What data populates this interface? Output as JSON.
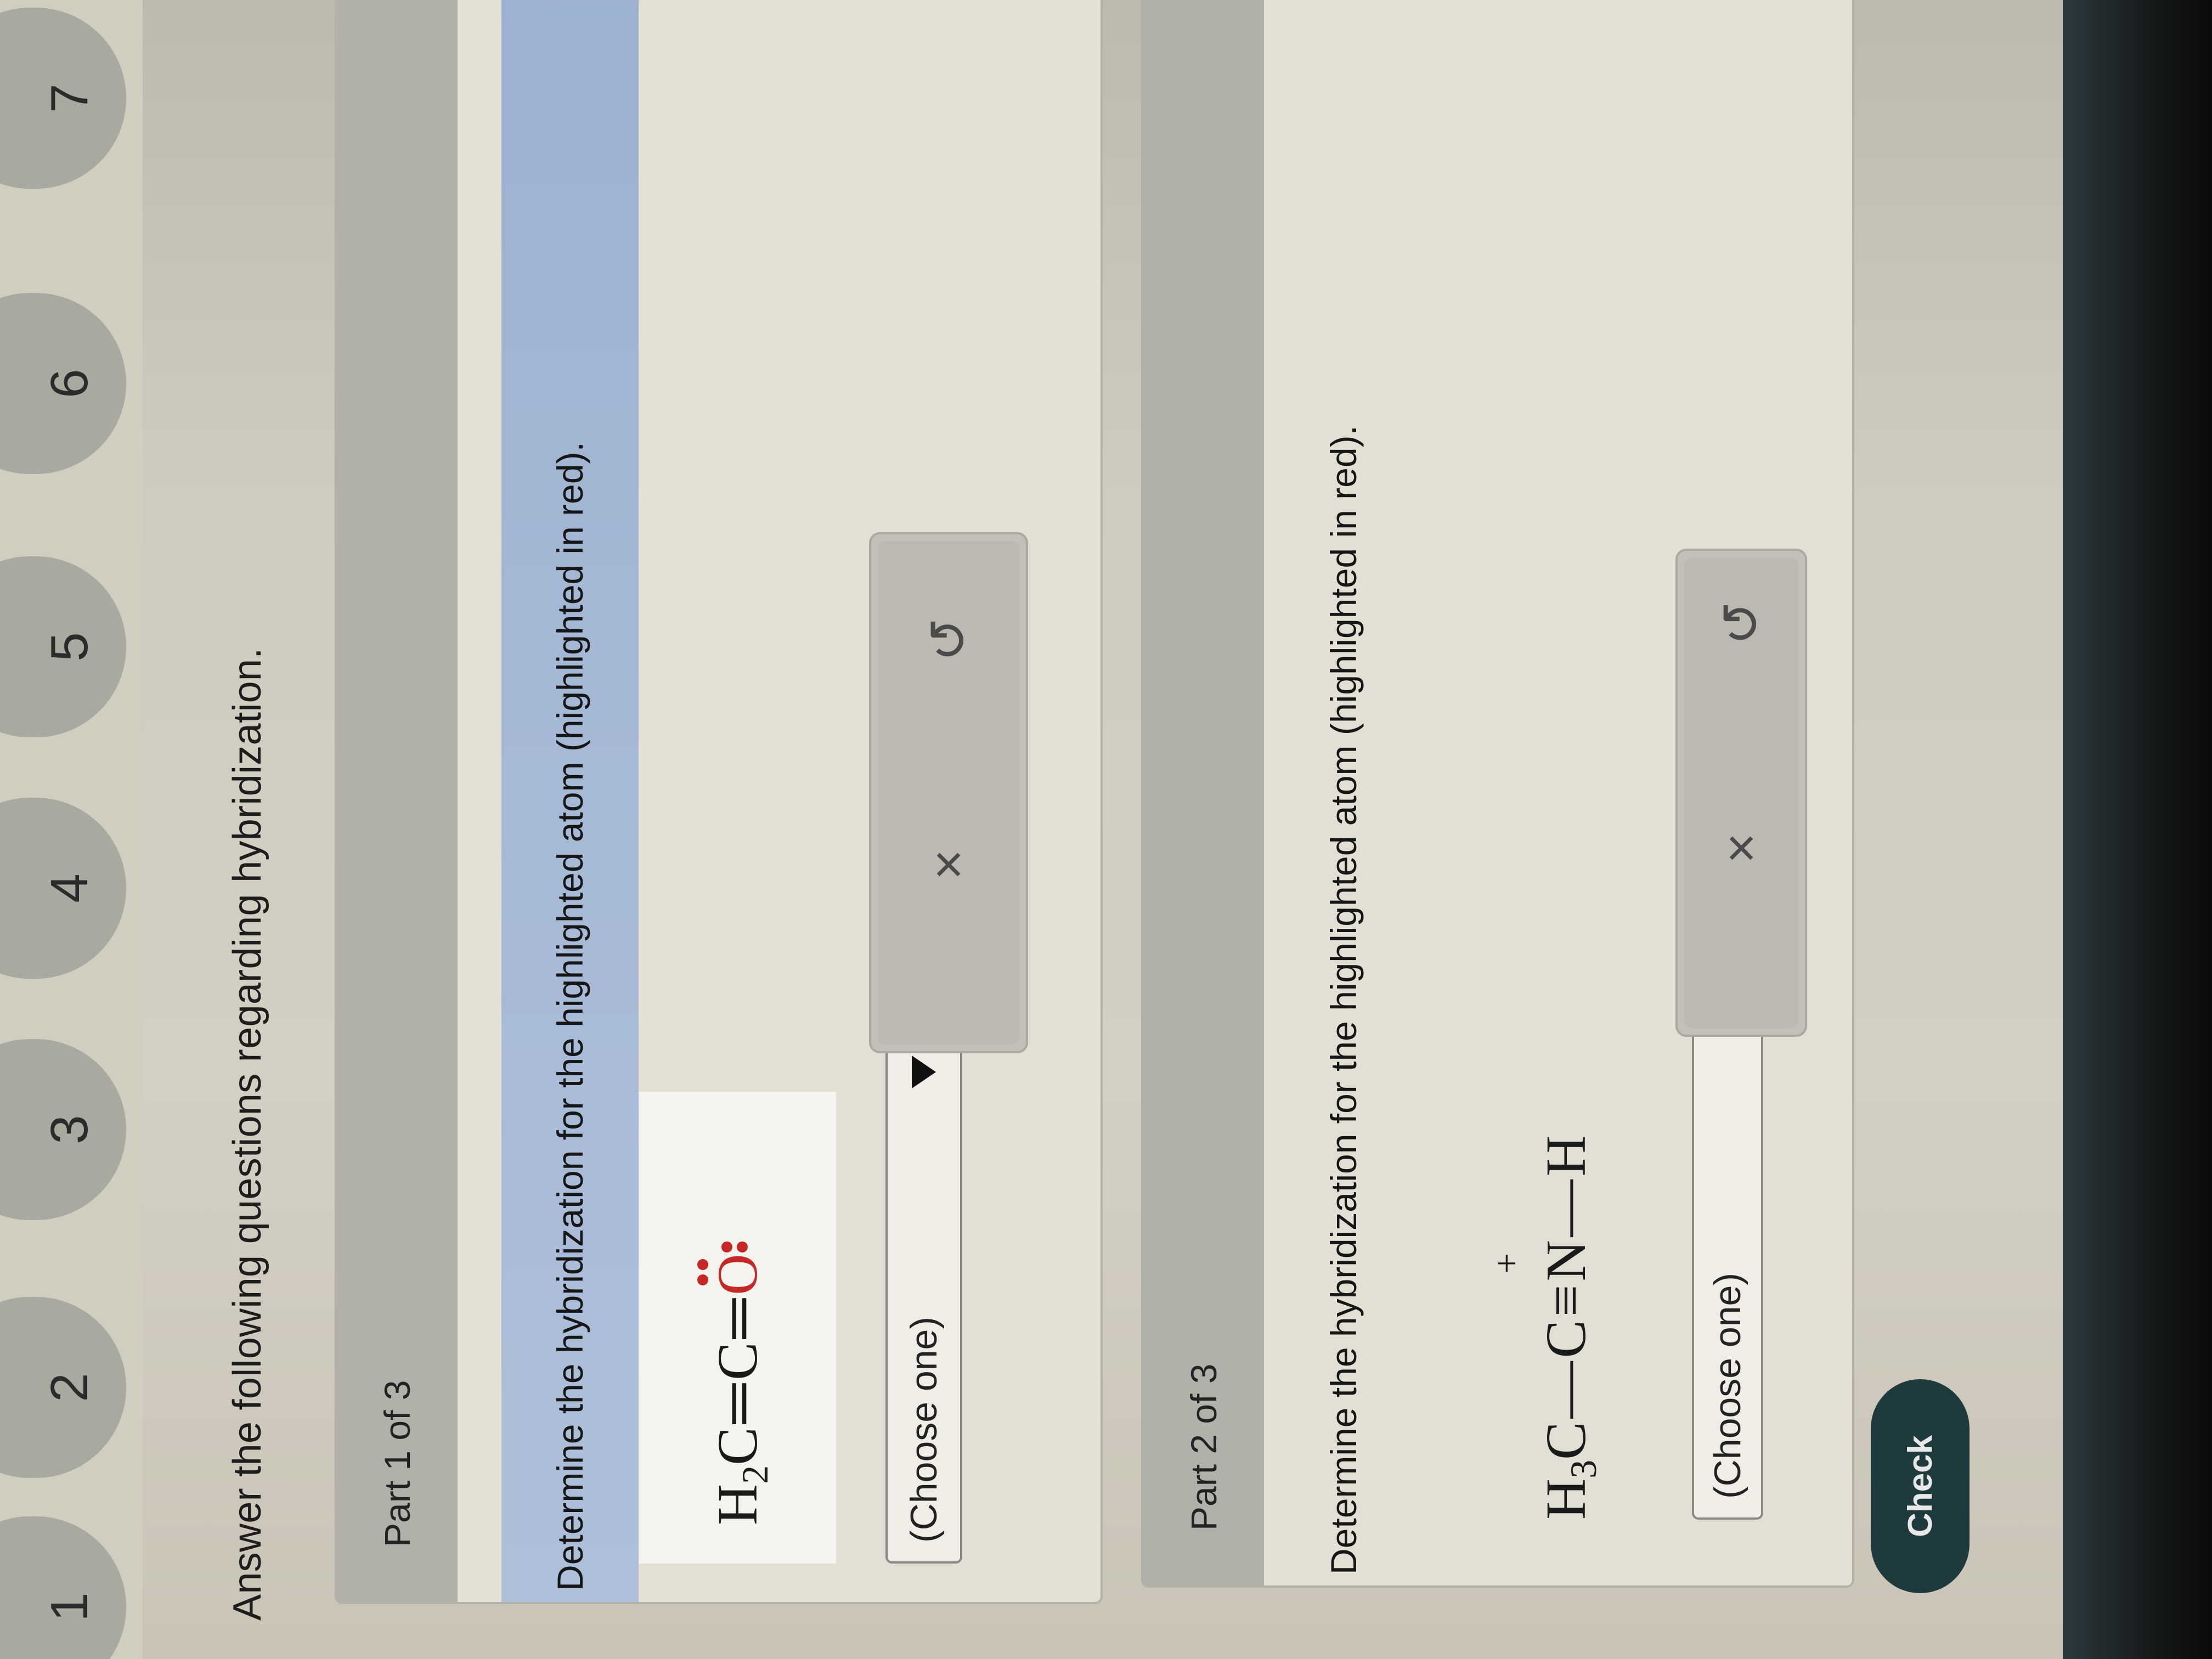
{
  "nav": {
    "items": [
      "1",
      "2",
      "3",
      "4",
      "5",
      "6",
      "7"
    ]
  },
  "instruction": "Answer the following questions regarding hybridization.",
  "part1": {
    "header": "Part 1 of 3",
    "prompt": "Determine the hybridization for the highlighted atom (highlighted in red).",
    "molecule": {
      "h": "H",
      "h_subscript": "2",
      "c1": "C",
      "bond1": "═",
      "c2": "C",
      "bond2": "═",
      "highlighted_atom": "O"
    },
    "dropdown_value": "(Choose one)"
  },
  "part2": {
    "header": "Part 2 of 3",
    "prompt": "Determine the hybridization for the highlighted atom (highlighted in red).",
    "molecule": {
      "h": "H",
      "h_subscript": "3",
      "c1": "C",
      "bond1": "—",
      "c2": "C",
      "bond2": "≡",
      "n": "N",
      "charge": "+",
      "bond3": "—",
      "h_end": "H"
    },
    "dropdown_value": "(Choose one)"
  },
  "actions": {
    "clear_glyph": "×",
    "undo_glyph": "↺"
  },
  "check_label": "Check",
  "colors": {
    "highlight": "#c62828",
    "prompt_band": "#a6b9d6",
    "check_button": "#1f3a3d"
  }
}
